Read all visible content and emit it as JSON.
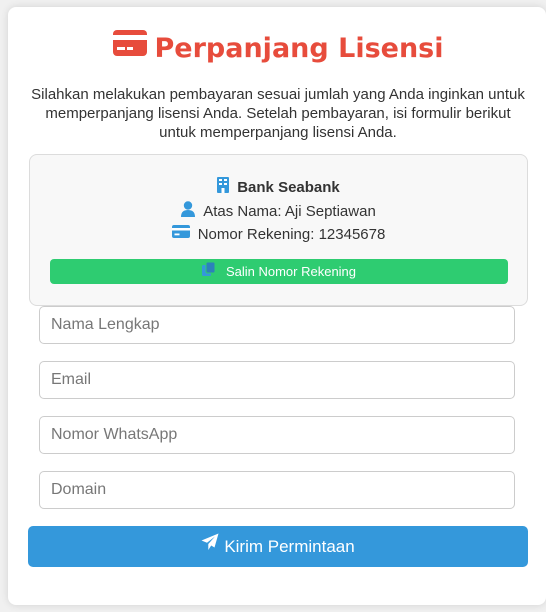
{
  "header": {
    "title": "Perpanjang Lisensi",
    "title_icon": "credit-card-icon",
    "title_color": "#e74c3c"
  },
  "description": "Silahkan melakukan pembayaran sesuai jumlah yang Anda inginkan untuk memperpanjang lisensi Anda. Setelah pembayaran, isi formulir berikut untuk memperpanjang lisensi Anda.",
  "bank": {
    "name": "Bank Seabank",
    "name_icon": "building-icon",
    "holder": "Atas Nama: Aji Septiawan",
    "holder_icon": "user-icon",
    "account": "Nomor Rekening: 12345678",
    "account_icon": "credit-card-icon",
    "icon_color": "#3498db",
    "copy_button": {
      "label": "Salin Nomor Rekening",
      "icon": "copy-icon",
      "color": "#2ecc71"
    }
  },
  "form": {
    "fields": [
      {
        "placeholder": "Nama Lengkap",
        "value": ""
      },
      {
        "placeholder": "Email",
        "value": ""
      },
      {
        "placeholder": "Nomor WhatsApp",
        "value": ""
      },
      {
        "placeholder": "Domain",
        "value": ""
      }
    ],
    "submit": {
      "label": "Kirim Permintaan",
      "icon": "paper-plane-icon",
      "color": "#3498db"
    }
  }
}
